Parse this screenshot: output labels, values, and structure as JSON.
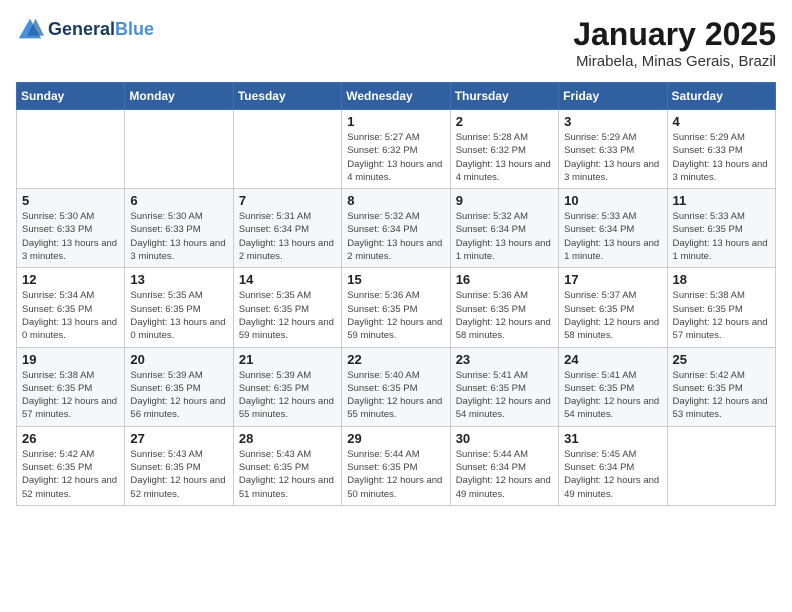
{
  "header": {
    "logo_line1": "General",
    "logo_line2": "Blue",
    "month_title": "January 2025",
    "location": "Mirabela, Minas Gerais, Brazil"
  },
  "weekdays": [
    "Sunday",
    "Monday",
    "Tuesday",
    "Wednesday",
    "Thursday",
    "Friday",
    "Saturday"
  ],
  "weeks": [
    [
      {
        "day": "",
        "info": ""
      },
      {
        "day": "",
        "info": ""
      },
      {
        "day": "",
        "info": ""
      },
      {
        "day": "1",
        "info": "Sunrise: 5:27 AM\nSunset: 6:32 PM\nDaylight: 13 hours and 4 minutes."
      },
      {
        "day": "2",
        "info": "Sunrise: 5:28 AM\nSunset: 6:32 PM\nDaylight: 13 hours and 4 minutes."
      },
      {
        "day": "3",
        "info": "Sunrise: 5:29 AM\nSunset: 6:33 PM\nDaylight: 13 hours and 3 minutes."
      },
      {
        "day": "4",
        "info": "Sunrise: 5:29 AM\nSunset: 6:33 PM\nDaylight: 13 hours and 3 minutes."
      }
    ],
    [
      {
        "day": "5",
        "info": "Sunrise: 5:30 AM\nSunset: 6:33 PM\nDaylight: 13 hours and 3 minutes."
      },
      {
        "day": "6",
        "info": "Sunrise: 5:30 AM\nSunset: 6:33 PM\nDaylight: 13 hours and 3 minutes."
      },
      {
        "day": "7",
        "info": "Sunrise: 5:31 AM\nSunset: 6:34 PM\nDaylight: 13 hours and 2 minutes."
      },
      {
        "day": "8",
        "info": "Sunrise: 5:32 AM\nSunset: 6:34 PM\nDaylight: 13 hours and 2 minutes."
      },
      {
        "day": "9",
        "info": "Sunrise: 5:32 AM\nSunset: 6:34 PM\nDaylight: 13 hours and 1 minute."
      },
      {
        "day": "10",
        "info": "Sunrise: 5:33 AM\nSunset: 6:34 PM\nDaylight: 13 hours and 1 minute."
      },
      {
        "day": "11",
        "info": "Sunrise: 5:33 AM\nSunset: 6:35 PM\nDaylight: 13 hours and 1 minute."
      }
    ],
    [
      {
        "day": "12",
        "info": "Sunrise: 5:34 AM\nSunset: 6:35 PM\nDaylight: 13 hours and 0 minutes."
      },
      {
        "day": "13",
        "info": "Sunrise: 5:35 AM\nSunset: 6:35 PM\nDaylight: 13 hours and 0 minutes."
      },
      {
        "day": "14",
        "info": "Sunrise: 5:35 AM\nSunset: 6:35 PM\nDaylight: 12 hours and 59 minutes."
      },
      {
        "day": "15",
        "info": "Sunrise: 5:36 AM\nSunset: 6:35 PM\nDaylight: 12 hours and 59 minutes."
      },
      {
        "day": "16",
        "info": "Sunrise: 5:36 AM\nSunset: 6:35 PM\nDaylight: 12 hours and 58 minutes."
      },
      {
        "day": "17",
        "info": "Sunrise: 5:37 AM\nSunset: 6:35 PM\nDaylight: 12 hours and 58 minutes."
      },
      {
        "day": "18",
        "info": "Sunrise: 5:38 AM\nSunset: 6:35 PM\nDaylight: 12 hours and 57 minutes."
      }
    ],
    [
      {
        "day": "19",
        "info": "Sunrise: 5:38 AM\nSunset: 6:35 PM\nDaylight: 12 hours and 57 minutes."
      },
      {
        "day": "20",
        "info": "Sunrise: 5:39 AM\nSunset: 6:35 PM\nDaylight: 12 hours and 56 minutes."
      },
      {
        "day": "21",
        "info": "Sunrise: 5:39 AM\nSunset: 6:35 PM\nDaylight: 12 hours and 55 minutes."
      },
      {
        "day": "22",
        "info": "Sunrise: 5:40 AM\nSunset: 6:35 PM\nDaylight: 12 hours and 55 minutes."
      },
      {
        "day": "23",
        "info": "Sunrise: 5:41 AM\nSunset: 6:35 PM\nDaylight: 12 hours and 54 minutes."
      },
      {
        "day": "24",
        "info": "Sunrise: 5:41 AM\nSunset: 6:35 PM\nDaylight: 12 hours and 54 minutes."
      },
      {
        "day": "25",
        "info": "Sunrise: 5:42 AM\nSunset: 6:35 PM\nDaylight: 12 hours and 53 minutes."
      }
    ],
    [
      {
        "day": "26",
        "info": "Sunrise: 5:42 AM\nSunset: 6:35 PM\nDaylight: 12 hours and 52 minutes."
      },
      {
        "day": "27",
        "info": "Sunrise: 5:43 AM\nSunset: 6:35 PM\nDaylight: 12 hours and 52 minutes."
      },
      {
        "day": "28",
        "info": "Sunrise: 5:43 AM\nSunset: 6:35 PM\nDaylight: 12 hours and 51 minutes."
      },
      {
        "day": "29",
        "info": "Sunrise: 5:44 AM\nSunset: 6:35 PM\nDaylight: 12 hours and 50 minutes."
      },
      {
        "day": "30",
        "info": "Sunrise: 5:44 AM\nSunset: 6:34 PM\nDaylight: 12 hours and 49 minutes."
      },
      {
        "day": "31",
        "info": "Sunrise: 5:45 AM\nSunset: 6:34 PM\nDaylight: 12 hours and 49 minutes."
      },
      {
        "day": "",
        "info": ""
      }
    ]
  ]
}
